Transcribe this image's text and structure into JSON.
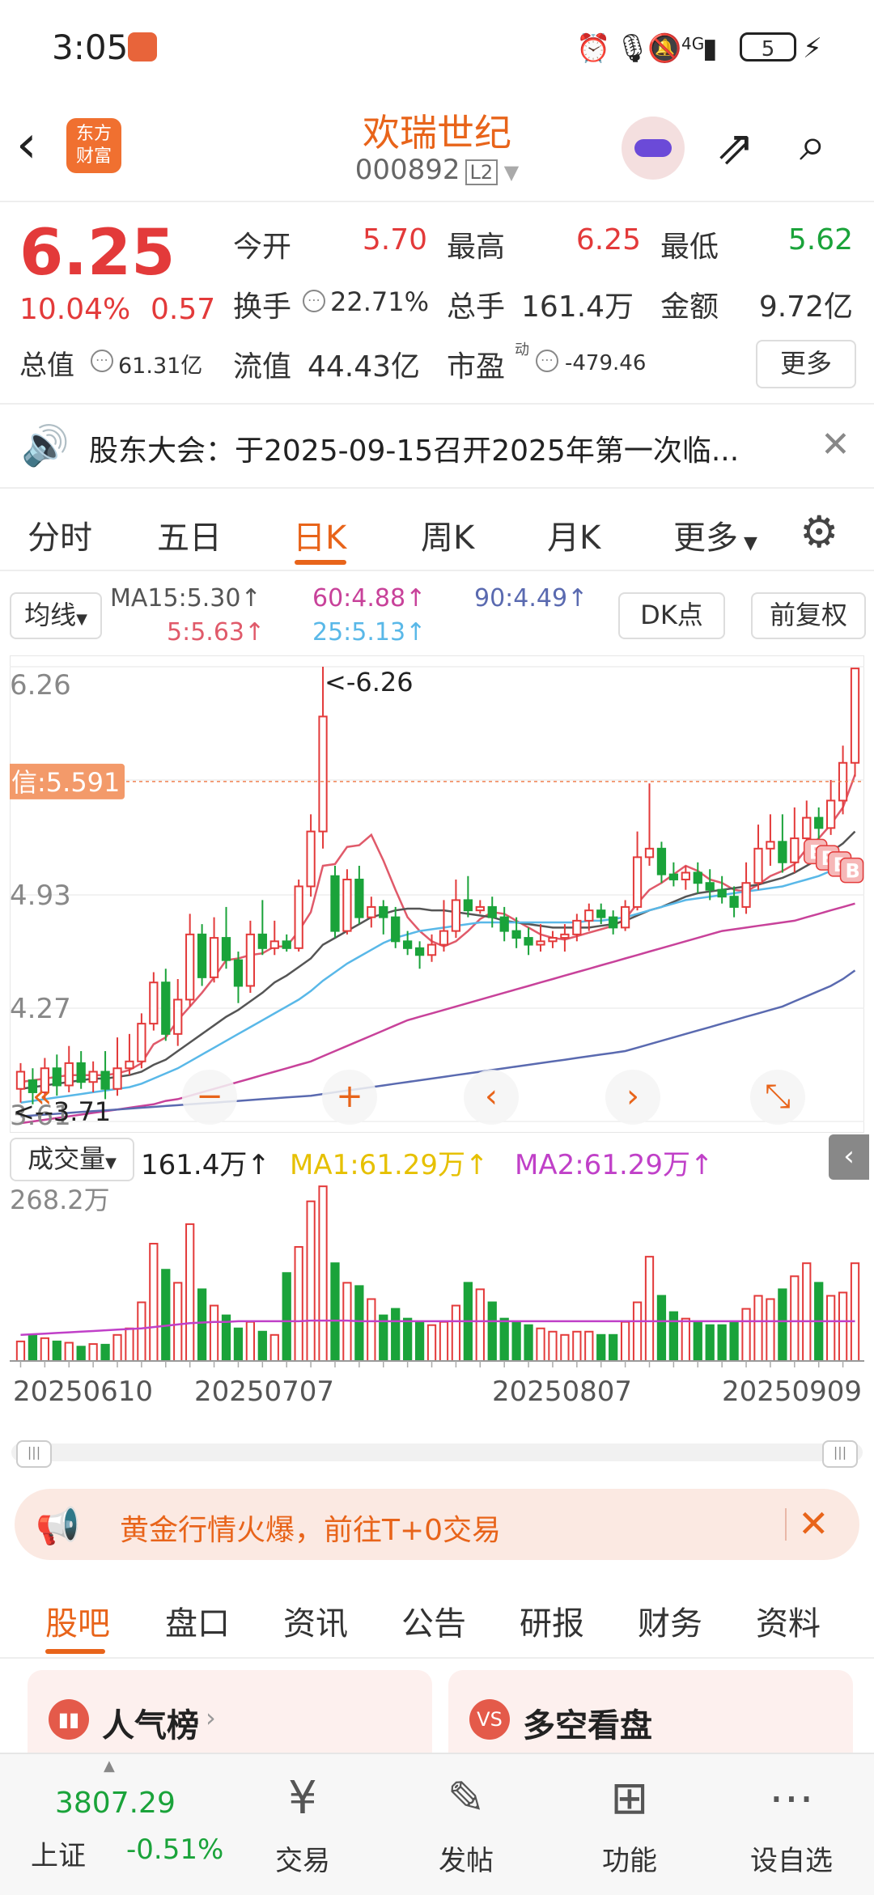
{
  "status_bar": {
    "time": "3:05",
    "network": "4G",
    "battery": "5"
  },
  "header": {
    "stock_name": "欢瑞世纪",
    "stock_code": "000892",
    "level": "L2",
    "brand": "东方\n财富"
  },
  "quote": {
    "price": "6.25",
    "change_pct": "10.04%",
    "change": "0.57",
    "open_label": "今开",
    "open": "5.70",
    "high_label": "最高",
    "high": "6.25",
    "low_label": "最低",
    "low": "5.62",
    "turnover_label": "换手",
    "turnover": "22.71%",
    "volume_label": "总手",
    "volume": "161.4万",
    "amount_label": "金额",
    "amount": "9.72亿",
    "mktcap_label": "总值",
    "mktcap": "61.31亿",
    "float_label": "流值",
    "float_cap": "44.43亿",
    "pe_label": "市盈",
    "pe_sup": "动",
    "pe": "-479.46",
    "more": "更多"
  },
  "notice": {
    "text": "股东大会：于2025-09-15召开2025年第一次临..."
  },
  "period_tabs": [
    "分时",
    "五日",
    "日K",
    "周K",
    "月K",
    "更多"
  ],
  "ma_header": {
    "selector": "均线",
    "ma5": "5:5.63↑",
    "ma15": "MA15:5.30↑",
    "ma25": "25:5.13↑",
    "ma60": "60:4.88↑",
    "ma90": "90:4.49↑",
    "dk_button": "DK点",
    "adjust_button": "前复权"
  },
  "colors": {
    "up": "#e33a3a",
    "down": "#1aa33a",
    "accent": "#e8641a",
    "ma5": "#e05a6a",
    "ma15": "#555555",
    "ma25": "#59b8e8",
    "ma60": "#c8429a",
    "ma90": "#5a6ab0"
  },
  "chart_data": {
    "type": "candlestick",
    "y_ticks": [
      "6.26",
      "5.60",
      "4.93",
      "4.27",
      "3.61"
    ],
    "ylim": [
      3.61,
      6.26
    ],
    "signal_label": "信:5.591",
    "high_marker": "<-6.26",
    "low_marker": "<--3.71",
    "buy_markers": [
      "B",
      "B",
      "B",
      "B"
    ],
    "candles": [
      [
        3.8,
        3.9,
        3.72,
        3.95
      ],
      [
        3.85,
        3.78,
        3.71,
        3.92
      ],
      [
        3.78,
        3.92,
        3.74,
        3.98
      ],
      [
        3.92,
        3.82,
        3.76,
        4.0
      ],
      [
        3.82,
        3.95,
        3.78,
        4.05
      ],
      [
        3.95,
        3.84,
        3.8,
        4.02
      ],
      [
        3.84,
        3.9,
        3.78,
        3.96
      ],
      [
        3.9,
        3.8,
        3.74,
        4.02
      ],
      [
        3.8,
        3.92,
        3.76,
        4.1
      ],
      [
        3.92,
        3.96,
        3.88,
        4.12
      ],
      [
        3.96,
        4.18,
        3.92,
        4.24
      ],
      [
        4.18,
        4.42,
        4.14,
        4.48
      ],
      [
        4.42,
        4.12,
        4.08,
        4.5
      ],
      [
        4.12,
        4.32,
        4.05,
        4.44
      ],
      [
        4.32,
        4.7,
        4.28,
        4.82
      ],
      [
        4.7,
        4.45,
        4.4,
        4.76
      ],
      [
        4.45,
        4.68,
        4.42,
        4.8
      ],
      [
        4.68,
        4.55,
        4.5,
        4.86
      ],
      [
        4.55,
        4.4,
        4.3,
        4.6
      ],
      [
        4.4,
        4.7,
        4.36,
        4.78
      ],
      [
        4.7,
        4.62,
        4.58,
        4.9
      ],
      [
        4.62,
        4.66,
        4.58,
        4.78
      ],
      [
        4.66,
        4.62,
        4.6,
        4.7
      ],
      [
        4.62,
        4.98,
        4.6,
        5.02
      ],
      [
        4.98,
        5.3,
        4.92,
        5.4
      ],
      [
        5.3,
        5.97,
        5.2,
        6.26
      ],
      [
        5.04,
        4.72,
        4.68,
        5.1
      ],
      [
        4.72,
        5.02,
        4.7,
        5.08
      ],
      [
        5.02,
        4.8,
        4.76,
        5.1
      ],
      [
        4.8,
        4.86,
        4.74,
        4.92
      ],
      [
        4.86,
        4.8,
        4.7,
        4.9
      ],
      [
        4.8,
        4.66,
        4.62,
        4.86
      ],
      [
        4.66,
        4.62,
        4.58,
        4.72
      ],
      [
        4.62,
        4.58,
        4.5,
        4.66
      ],
      [
        4.58,
        4.64,
        4.54,
        4.7
      ],
      [
        4.64,
        4.72,
        4.6,
        4.9
      ],
      [
        4.72,
        4.9,
        4.68,
        5.02
      ],
      [
        4.9,
        4.84,
        4.8,
        5.04
      ],
      [
        4.84,
        4.86,
        4.82,
        4.9
      ],
      [
        4.86,
        4.8,
        4.74,
        4.92
      ],
      [
        4.8,
        4.72,
        4.66,
        4.86
      ],
      [
        4.72,
        4.68,
        4.62,
        4.8
      ],
      [
        4.68,
        4.64,
        4.58,
        4.74
      ],
      [
        4.64,
        4.66,
        4.6,
        4.76
      ],
      [
        4.66,
        4.68,
        4.62,
        4.72
      ],
      [
        4.68,
        4.7,
        4.6,
        4.76
      ],
      [
        4.7,
        4.78,
        4.66,
        4.82
      ],
      [
        4.78,
        4.84,
        4.72,
        4.88
      ],
      [
        4.84,
        4.8,
        4.76,
        4.88
      ],
      [
        4.8,
        4.74,
        4.7,
        4.84
      ],
      [
        4.74,
        4.86,
        4.72,
        4.9
      ],
      [
        4.86,
        5.15,
        4.84,
        5.3
      ],
      [
        5.15,
        5.2,
        5.1,
        5.58
      ],
      [
        5.2,
        5.05,
        5.0,
        5.24
      ],
      [
        5.05,
        5.02,
        4.98,
        5.12
      ],
      [
        5.02,
        5.06,
        4.96,
        5.1
      ],
      [
        5.06,
        5.0,
        4.94,
        5.12
      ],
      [
        5.0,
        4.96,
        4.9,
        5.08
      ],
      [
        4.96,
        4.92,
        4.88,
        5.04
      ],
      [
        4.92,
        4.86,
        4.8,
        4.98
      ],
      [
        4.86,
        5.0,
        4.82,
        5.12
      ],
      [
        5.0,
        5.2,
        4.96,
        5.34
      ],
      [
        5.2,
        5.24,
        5.1,
        5.4
      ],
      [
        5.24,
        5.12,
        5.06,
        5.4
      ],
      [
        5.12,
        5.26,
        5.06,
        5.44
      ],
      [
        5.26,
        5.38,
        5.2,
        5.48
      ],
      [
        5.38,
        5.32,
        5.24,
        5.44
      ],
      [
        5.32,
        5.48,
        5.28,
        5.6
      ],
      [
        5.48,
        5.7,
        5.4,
        5.8
      ],
      [
        5.7,
        6.25,
        5.62,
        6.25
      ]
    ],
    "ma_series": {
      "ma5": [
        3.84,
        3.85,
        3.86,
        3.87,
        3.88,
        3.88,
        3.88,
        3.88,
        3.89,
        3.91,
        3.95,
        4.06,
        4.1,
        4.2,
        4.28,
        4.36,
        4.45,
        4.55,
        4.56,
        4.58,
        4.59,
        4.63,
        4.63,
        4.72,
        4.83,
        5.1,
        5.11,
        5.21,
        5.22,
        5.28,
        5.13,
        4.96,
        4.8,
        4.72,
        4.66,
        4.63,
        4.66,
        4.72,
        4.79,
        4.83,
        4.82,
        4.78,
        4.74,
        4.7,
        4.68,
        4.67,
        4.69,
        4.71,
        4.73,
        4.75,
        4.79,
        4.88,
        4.96,
        5.0,
        5.05,
        5.1,
        5.07,
        5.02,
        5.0,
        4.96,
        4.95,
        4.99,
        5.04,
        5.07,
        5.11,
        5.2,
        5.26,
        5.34,
        5.44,
        5.63
      ],
      "ma15": [
        3.8,
        3.81,
        3.82,
        3.83,
        3.84,
        3.85,
        3.86,
        3.86,
        3.87,
        3.88,
        3.9,
        3.94,
        3.97,
        4.02,
        4.07,
        4.12,
        4.17,
        4.22,
        4.26,
        4.31,
        4.36,
        4.42,
        4.46,
        4.51,
        4.56,
        4.64,
        4.68,
        4.72,
        4.76,
        4.8,
        4.82,
        4.84,
        4.85,
        4.85,
        4.84,
        4.84,
        4.83,
        4.82,
        4.81,
        4.8,
        4.78,
        4.77,
        4.76,
        4.75,
        4.74,
        4.74,
        4.74,
        4.74,
        4.75,
        4.76,
        4.78,
        4.81,
        4.84,
        4.86,
        4.89,
        4.92,
        4.94,
        4.95,
        4.96,
        4.97,
        4.98,
        4.99,
        5.01,
        5.03,
        5.06,
        5.1,
        5.14,
        5.18,
        5.23,
        5.3
      ],
      "ma25": [
        3.72,
        3.73,
        3.74,
        3.75,
        3.76,
        3.77,
        3.78,
        3.79,
        3.8,
        3.81,
        3.83,
        3.86,
        3.89,
        3.92,
        3.96,
        4.0,
        4.04,
        4.08,
        4.12,
        4.16,
        4.2,
        4.24,
        4.28,
        4.32,
        4.37,
        4.43,
        4.48,
        4.53,
        4.57,
        4.61,
        4.65,
        4.68,
        4.7,
        4.72,
        4.73,
        4.74,
        4.75,
        4.76,
        4.77,
        4.77,
        4.77,
        4.77,
        4.77,
        4.77,
        4.77,
        4.77,
        4.77,
        4.78,
        4.78,
        4.79,
        4.8,
        4.82,
        4.84,
        4.86,
        4.88,
        4.9,
        4.91,
        4.92,
        4.93,
        4.94,
        4.95,
        4.96,
        4.97,
        4.98,
        5.0,
        5.02,
        5.04,
        5.07,
        5.1,
        5.13
      ],
      "ma60": [
        3.6,
        3.61,
        3.62,
        3.63,
        3.64,
        3.65,
        3.66,
        3.67,
        3.68,
        3.69,
        3.7,
        3.71,
        3.73,
        3.74,
        3.76,
        3.78,
        3.8,
        3.82,
        3.84,
        3.86,
        3.88,
        3.9,
        3.92,
        3.94,
        3.96,
        3.99,
        4.02,
        4.05,
        4.08,
        4.11,
        4.14,
        4.17,
        4.2,
        4.22,
        4.24,
        4.26,
        4.28,
        4.3,
        4.32,
        4.34,
        4.36,
        4.38,
        4.4,
        4.42,
        4.44,
        4.46,
        4.48,
        4.5,
        4.52,
        4.54,
        4.56,
        4.58,
        4.6,
        4.62,
        4.64,
        4.66,
        4.68,
        4.7,
        4.72,
        4.73,
        4.74,
        4.75,
        4.76,
        4.77,
        4.78,
        4.8,
        4.82,
        4.84,
        4.86,
        4.88
      ],
      "ma90": [
        3.64,
        3.645,
        3.65,
        3.655,
        3.66,
        3.665,
        3.67,
        3.675,
        3.68,
        3.685,
        3.69,
        3.695,
        3.7,
        3.705,
        3.71,
        3.715,
        3.72,
        3.725,
        3.73,
        3.735,
        3.74,
        3.745,
        3.75,
        3.755,
        3.76,
        3.77,
        3.78,
        3.79,
        3.8,
        3.81,
        3.82,
        3.83,
        3.84,
        3.85,
        3.86,
        3.87,
        3.88,
        3.89,
        3.9,
        3.91,
        3.92,
        3.93,
        3.94,
        3.95,
        3.96,
        3.97,
        3.98,
        3.99,
        4.0,
        4.01,
        4.02,
        4.04,
        4.06,
        4.08,
        4.1,
        4.12,
        4.14,
        4.16,
        4.18,
        4.2,
        4.22,
        4.24,
        4.26,
        4.28,
        4.31,
        4.34,
        4.37,
        4.4,
        4.44,
        4.49
      ]
    },
    "volume_header": {
      "selector": "成交量",
      "value": "161.4万↑",
      "ma1": "MA1:61.29万↑",
      "ma2": "MA2:61.29万↑"
    },
    "volume_ymax_label": "268.2万",
    "volume_ylim": [
      0,
      268.2
    ],
    "volumes": [
      30,
      40,
      35,
      30,
      28,
      22,
      26,
      25,
      40,
      50,
      90,
      180,
      140,
      120,
      210,
      110,
      85,
      70,
      50,
      60,
      45,
      40,
      135,
      175,
      245,
      268,
      150,
      120,
      115,
      95,
      70,
      80,
      65,
      60,
      55,
      60,
      85,
      120,
      110,
      90,
      65,
      60,
      55,
      50,
      45,
      40,
      45,
      45,
      40,
      40,
      60,
      90,
      160,
      100,
      75,
      65,
      60,
      55,
      55,
      60,
      80,
      100,
      95,
      110,
      130,
      150,
      120,
      100,
      105,
      150
    ],
    "volume_ma": [
      40,
      41,
      42,
      43,
      44,
      45,
      46,
      47,
      48,
      49,
      50,
      52,
      54,
      56,
      58,
      59,
      60,
      60,
      61,
      61,
      61,
      61,
      61,
      61,
      62,
      62,
      62,
      62,
      61,
      61,
      61,
      61,
      61,
      61,
      61,
      61,
      61,
      61,
      61,
      61,
      61,
      61,
      61,
      61,
      61,
      61,
      61,
      61,
      61,
      61,
      61,
      61,
      61,
      61,
      61,
      61,
      61,
      61,
      61,
      61,
      61,
      61,
      61,
      61,
      61,
      61,
      61,
      61,
      61,
      61
    ],
    "x_dates": [
      "20250610",
      "20250707",
      "20250807",
      "20250909"
    ]
  },
  "promo": {
    "text": "黄金行情火爆，前往T+0交易"
  },
  "bottom_tabs": [
    "股吧",
    "盘口",
    "资讯",
    "公告",
    "研报",
    "财务",
    "资料"
  ],
  "cards": {
    "left_title": "人气榜",
    "right_title": "多空看盘",
    "right_icon": "VS"
  },
  "bottom_nav": {
    "index_value": "3807.29",
    "index_name": "上证",
    "index_change": "-0.51%",
    "items": [
      "交易",
      "发帖",
      "功能",
      "设自选"
    ]
  }
}
